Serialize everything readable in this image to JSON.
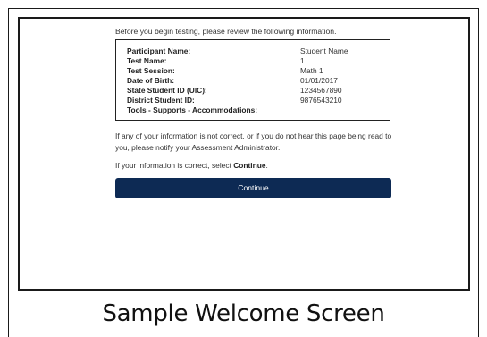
{
  "intro_text": "Before you begin testing, please review the following information.",
  "info": [
    {
      "label": "Participant Name:",
      "value": "Student Name"
    },
    {
      "label": "Test Name:",
      "value": "1"
    },
    {
      "label": "Test Session:",
      "value": "Math 1"
    },
    {
      "label": "Date of Birth:",
      "value": "01/01/2017"
    },
    {
      "label": "State Student ID (UIC):",
      "value": "1234567890"
    },
    {
      "label": "District Student ID:",
      "value": "9876543210"
    },
    {
      "label": "Tools - Supports - Accommodations:",
      "value": ""
    }
  ],
  "notice_text": "If any of your information is not correct, or if you do not hear this page being read to you, please notify your Assessment Administrator.",
  "correct_prefix": "If your information is correct, select ",
  "correct_emphasis": "Continue",
  "correct_suffix": ".",
  "continue_label": "Continue",
  "caption": "Sample Welcome Screen",
  "colors": {
    "button_bg": "#0d2a54",
    "button_text": "#ffffff",
    "border": "#1a1a1a"
  }
}
